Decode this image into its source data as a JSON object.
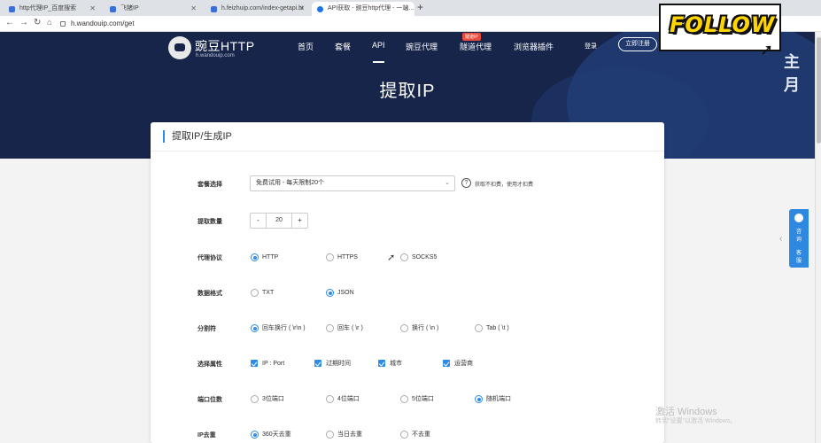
{
  "browser": {
    "tabs": [
      {
        "title": "http代理IP_百度搜索",
        "active": false,
        "color": "#3b6fd8"
      },
      {
        "title": "飞猪IP",
        "active": false,
        "color": "#3b6fd8"
      },
      {
        "title": "h.feizhuip.com/index-getapi.ht",
        "active": false,
        "color": "#3b6fd8"
      },
      {
        "title": "API获取 - 豌豆http代理 - 一站...",
        "active": true,
        "color": "#1a73e8"
      }
    ],
    "new_tab": "+",
    "url": "h.wandouip.com/get"
  },
  "site": {
    "brand": "豌豆HTTP",
    "domain": "h.wandouip.com",
    "menu": [
      {
        "label": "首页"
      },
      {
        "label": "套餐"
      },
      {
        "label": "API",
        "active": true
      },
      {
        "label": "豌豆代理"
      },
      {
        "label": "隧道代理"
      },
      {
        "label": "浏览器插件"
      }
    ],
    "badge": "隧道IP",
    "login": "登录",
    "register": "立即注册",
    "hero_title": "提取IP",
    "hero_right": "主月"
  },
  "overlay": {
    "follow": "FOLLOW"
  },
  "form": {
    "card_title": "提取IP/生成IP",
    "package_label": "套餐选择",
    "package_value": "免费试用 - 每天限制20个",
    "hint": "获取不扣费，使用才扣费",
    "qty_label": "提取数量",
    "qty_value": "20",
    "minus": "-",
    "plus": "+",
    "protocol_label": "代理协议",
    "protocol_options": [
      "HTTP",
      "HTTPS",
      "SOCKS5"
    ],
    "format_label": "数据格式",
    "format_options": [
      "TXT",
      "JSON"
    ],
    "separator_label": "分割符",
    "separator_options": [
      "回车换行 ( \\r\\n )",
      "回车 ( \\r )",
      "换行 ( \\n )",
      "Tab ( \\t )"
    ],
    "attr_label": "选择属性",
    "attr_options": [
      "IP : Port",
      "过期时间",
      "城市",
      "运营商"
    ],
    "port_label": "端口位数",
    "port_options": [
      "3位端口",
      "4位端口",
      "5位端口",
      "随机端口"
    ],
    "dedup_label": "IP去重",
    "dedup_options": [
      "360天去重",
      "当日去重",
      "不去重"
    ]
  },
  "float_tool": [
    "咨",
    "询",
    "客",
    "服"
  ],
  "watermark": {
    "line1": "激活 Windows",
    "line2": "转到\"设置\"以激活 Windows。"
  }
}
